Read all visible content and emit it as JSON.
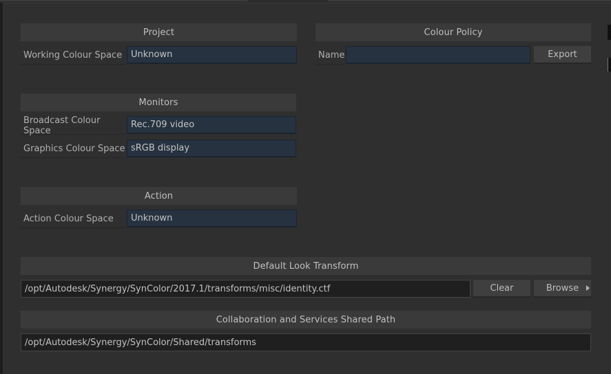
{
  "project": {
    "header": "Project",
    "working_colour_space": {
      "label": "Working Colour Space",
      "value": "Unknown"
    }
  },
  "monitors": {
    "header": "Monitors",
    "broadcast_colour_space": {
      "label": "Broadcast Colour Space",
      "value": "Rec.709 video"
    },
    "graphics_colour_space": {
      "label": "Graphics Colour Space",
      "value": "sRGB display"
    }
  },
  "action": {
    "header": "Action",
    "action_colour_space": {
      "label": "Action Colour Space",
      "value": "Unknown"
    }
  },
  "colour_policy": {
    "header": "Colour Policy",
    "name_label": "Name",
    "name_value": "",
    "export_label": "Export"
  },
  "default_look_transform": {
    "header": "Default Look Transform",
    "path": "/opt/Autodesk/Synergy/SynColor/2017.1/transforms/misc/identity.ctf",
    "clear_label": "Clear",
    "browse_label": "Browse"
  },
  "shared_path": {
    "header": "Collaboration and Services Shared Path",
    "path": "/opt/Autodesk/Synergy/SynColor/Shared/transforms"
  },
  "colors": {
    "panel_bg": "#2f2f2f",
    "header_bg": "#3a3a3a",
    "field_bg": "#263240",
    "button_bg": "#3f3f3f"
  }
}
